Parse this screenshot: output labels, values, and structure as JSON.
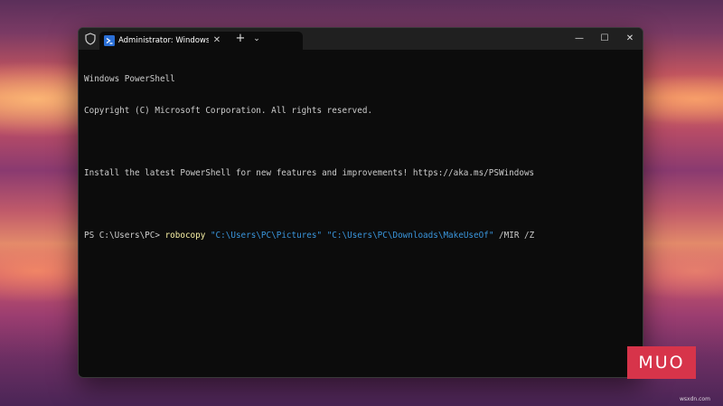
{
  "window": {
    "tab_title": "Administrator: Windows Powershell",
    "tab_close": "✕",
    "new_tab": "+",
    "dropdown": "⌄",
    "minimize": "—",
    "maximize": "☐",
    "close": "✕"
  },
  "console": {
    "line1": "Windows PowerShell",
    "line2": "Copyright (C) Microsoft Corporation. All rights reserved.",
    "line3": "Install the latest PowerShell for new features and improvements! https://aka.ms/PSWindows",
    "prompt": "PS C:\\Users\\PC> ",
    "command": "robocopy",
    "arg1": "\"C:\\Users\\PC\\Pictures\"",
    "arg2": "\"C:\\Users\\PC\\Downloads\\MakeUseOf\"",
    "flags": "/MIR /Z"
  },
  "colors": {
    "console_bg": "#0c0c0c",
    "titlebar_bg": "#202020",
    "command_color": "#f9f1a5",
    "string_color": "#3a96dd",
    "text_color": "#cccccc",
    "logo_bg": "#d7344a"
  },
  "icons": {
    "shield": "shield-icon",
    "powershell": "powershell-icon"
  },
  "branding": {
    "logo_text": "MUO",
    "watermark": "wsxdn.com"
  }
}
